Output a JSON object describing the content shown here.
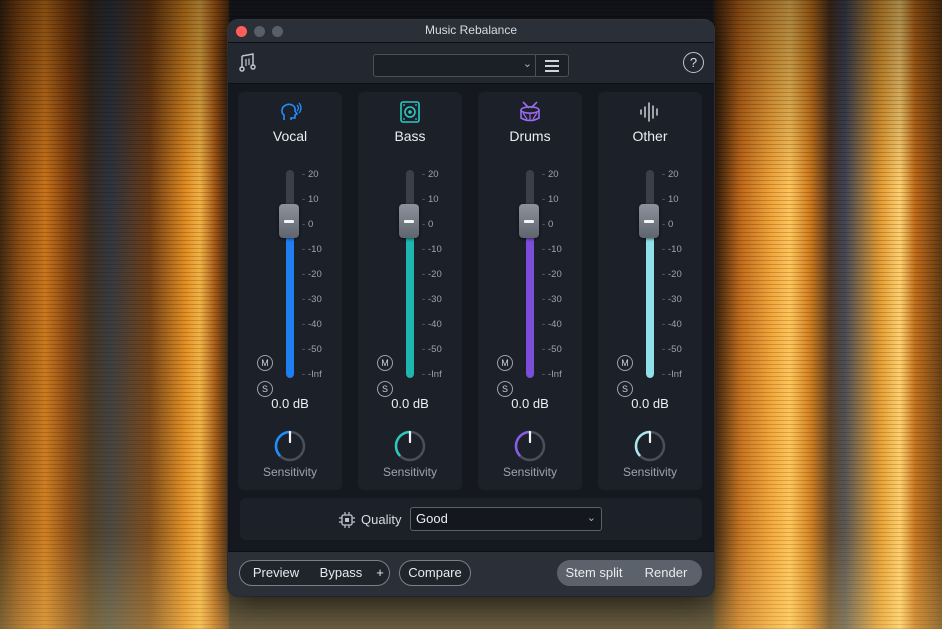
{
  "window": {
    "title": "Music Rebalance"
  },
  "toolbar": {
    "preset_value": "",
    "help_label": "?"
  },
  "strips": [
    {
      "name": "Vocal",
      "icon": "head-voice-icon",
      "color": "#1f7ff0",
      "gain": "0.0 dB",
      "mute": "M",
      "solo": "S",
      "sensitivity_label": "Sensitivity",
      "knob_color": "#1f8fff"
    },
    {
      "name": "Bass",
      "icon": "speaker-icon",
      "color": "#1fb5b0",
      "gain": "0.0 dB",
      "mute": "M",
      "solo": "S",
      "sensitivity_label": "Sensitivity",
      "knob_color": "#2fc8c0"
    },
    {
      "name": "Drums",
      "icon": "drum-icon",
      "color": "#7a4ed8",
      "gain": "0.0 dB",
      "mute": "M",
      "solo": "S",
      "sensitivity_label": "Sensitivity",
      "knob_color": "#8a5ce8"
    },
    {
      "name": "Other",
      "icon": "waveform-icon",
      "color": "#8fe0e8",
      "gain": "0.0 dB",
      "mute": "M",
      "solo": "S",
      "sensitivity_label": "Sensitivity",
      "knob_color": "#a8e8ee"
    }
  ],
  "scale_ticks": [
    "20",
    "10",
    "0",
    "-10",
    "-20",
    "-30",
    "-40",
    "-50",
    "-Inf"
  ],
  "quality": {
    "label": "Quality",
    "value": "Good"
  },
  "footer": {
    "preview": "Preview",
    "bypass": "Bypass",
    "plus": "+",
    "compare": "Compare",
    "stem_split": "Stem split",
    "render": "Render"
  }
}
